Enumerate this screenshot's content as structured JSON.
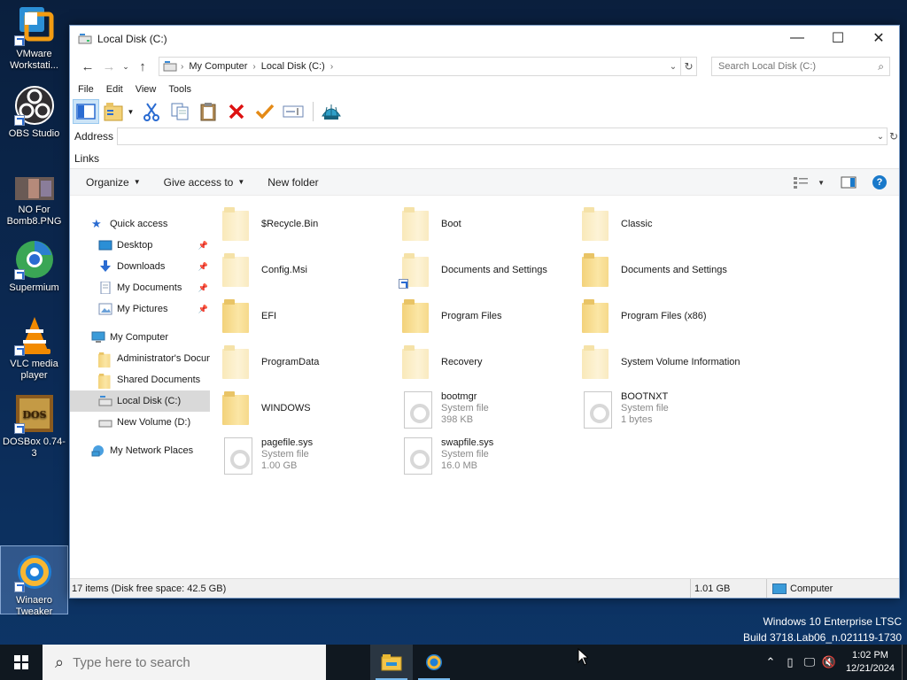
{
  "desktop": {
    "icons": [
      {
        "label": "VMware Workstati..."
      },
      {
        "label": "OBS Studio"
      },
      {
        "label": "NO For Bomb8.PNG"
      },
      {
        "label": "Supermium"
      },
      {
        "label": "VLC media player"
      },
      {
        "label": "DOSBox 0.74-3"
      },
      {
        "label": "Winaero Tweaker"
      }
    ]
  },
  "window": {
    "title": "Local Disk (C:)",
    "controls": {
      "minimize": "—",
      "maximize": "☐",
      "close": "✕"
    },
    "breadcrumb": [
      "My Computer",
      "Local Disk (C:)"
    ],
    "search_placeholder": "Search Local Disk (C:)",
    "menu": [
      "File",
      "Edit",
      "View",
      "Tools"
    ],
    "address_label": "Address",
    "links_label": "Links",
    "commands": {
      "organize": "Organize",
      "give_access": "Give access to",
      "new_folder": "New folder"
    },
    "sidebar": {
      "quick_access": "Quick access",
      "desktop": "Desktop",
      "downloads": "Downloads",
      "my_documents": "My Documents",
      "my_pictures": "My Pictures",
      "my_computer": "My Computer",
      "admin_docs": "Administrator's Docum",
      "shared_docs": "Shared Documents",
      "local_disk": "Local Disk (C:)",
      "new_volume": "New Volume (D:)",
      "network": "My Network Places"
    },
    "items": [
      {
        "name": "$Recycle.Bin",
        "type": "folder",
        "dim": true
      },
      {
        "name": "Boot",
        "type": "folder",
        "dim": true
      },
      {
        "name": "Classic",
        "type": "folder",
        "dim": true
      },
      {
        "name": "Config.Msi",
        "type": "folder",
        "dim": true
      },
      {
        "name": "Documents and Settings",
        "type": "folder",
        "dim": true,
        "shortcut": true
      },
      {
        "name": "Documents and Settings",
        "type": "folder",
        "dim": false
      },
      {
        "name": "EFI",
        "type": "folder",
        "dim": false
      },
      {
        "name": "Program Files",
        "type": "folder",
        "dim": false
      },
      {
        "name": "Program Files (x86)",
        "type": "folder",
        "dim": false
      },
      {
        "name": "ProgramData",
        "type": "folder",
        "dim": true
      },
      {
        "name": "Recovery",
        "type": "folder",
        "dim": true
      },
      {
        "name": "System Volume Information",
        "type": "folder",
        "dim": true
      },
      {
        "name": "WINDOWS",
        "type": "folder",
        "dim": false
      },
      {
        "name": "bootmgr",
        "type": "sysfile",
        "kind": "System file",
        "size": "398 KB"
      },
      {
        "name": "BOOTNXT",
        "type": "sysfile",
        "kind": "System file",
        "size": "1 bytes"
      },
      {
        "name": "pagefile.sys",
        "type": "sysfile",
        "kind": "System file",
        "size": "1.00 GB"
      },
      {
        "name": "swapfile.sys",
        "type": "sysfile",
        "kind": "System file",
        "size": "16.0 MB"
      }
    ],
    "status": {
      "summary": "17 items (Disk free space: 42.5 GB)",
      "size": "1.01 GB",
      "location": "Computer"
    }
  },
  "watermark": {
    "line1": "Windows 10 Enterprise LTSC",
    "line2": "Build 3718.Lab06_n.021119-1730"
  },
  "taskbar": {
    "search_placeholder": "Type here to search",
    "time": "1:02 PM",
    "date": "12/21/2024"
  },
  "colors": {
    "accent": "#1979ca",
    "selected_bg": "#cce4f7",
    "folder": "#f3d27a"
  }
}
